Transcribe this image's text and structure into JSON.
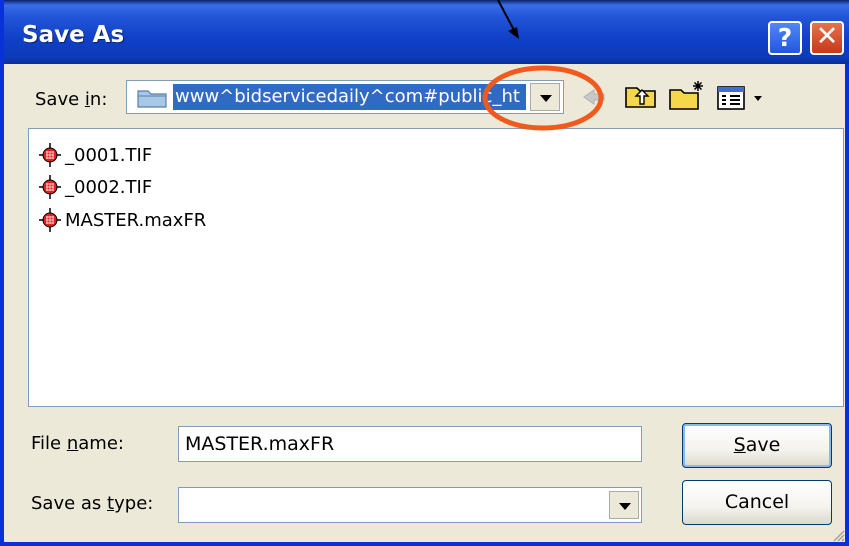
{
  "window": {
    "title": "Save As"
  },
  "titlebar_buttons": {
    "help_label": "?",
    "close_label": "✕"
  },
  "save_in": {
    "label_prefix": "Save ",
    "label_mnemonic": "i",
    "label_suffix": "n:",
    "selected_folder": "www^bidservicedaily^com#public_ht"
  },
  "files": [
    {
      "name": "_0001.TIF",
      "icon": "maxfr-file-icon"
    },
    {
      "name": "_0002.TIF",
      "icon": "maxfr-file-icon"
    },
    {
      "name": "MASTER.maxFR",
      "icon": "maxfr-file-icon"
    }
  ],
  "file_name": {
    "label_prefix": "File ",
    "label_mnemonic": "n",
    "label_suffix": "ame:",
    "value": "MASTER.maxFR"
  },
  "save_as_type": {
    "label_prefix": "Save as ",
    "label_mnemonic": "t",
    "label_suffix": "ype:",
    "value": ""
  },
  "buttons": {
    "save_mnemonic": "S",
    "save_rest": "ave",
    "cancel": "Cancel"
  },
  "colors": {
    "titlebar": "#0d3ab8",
    "dialog_bg": "#ece9d8",
    "selection": "#316ac5",
    "callout_circle": "#f05a1e"
  }
}
